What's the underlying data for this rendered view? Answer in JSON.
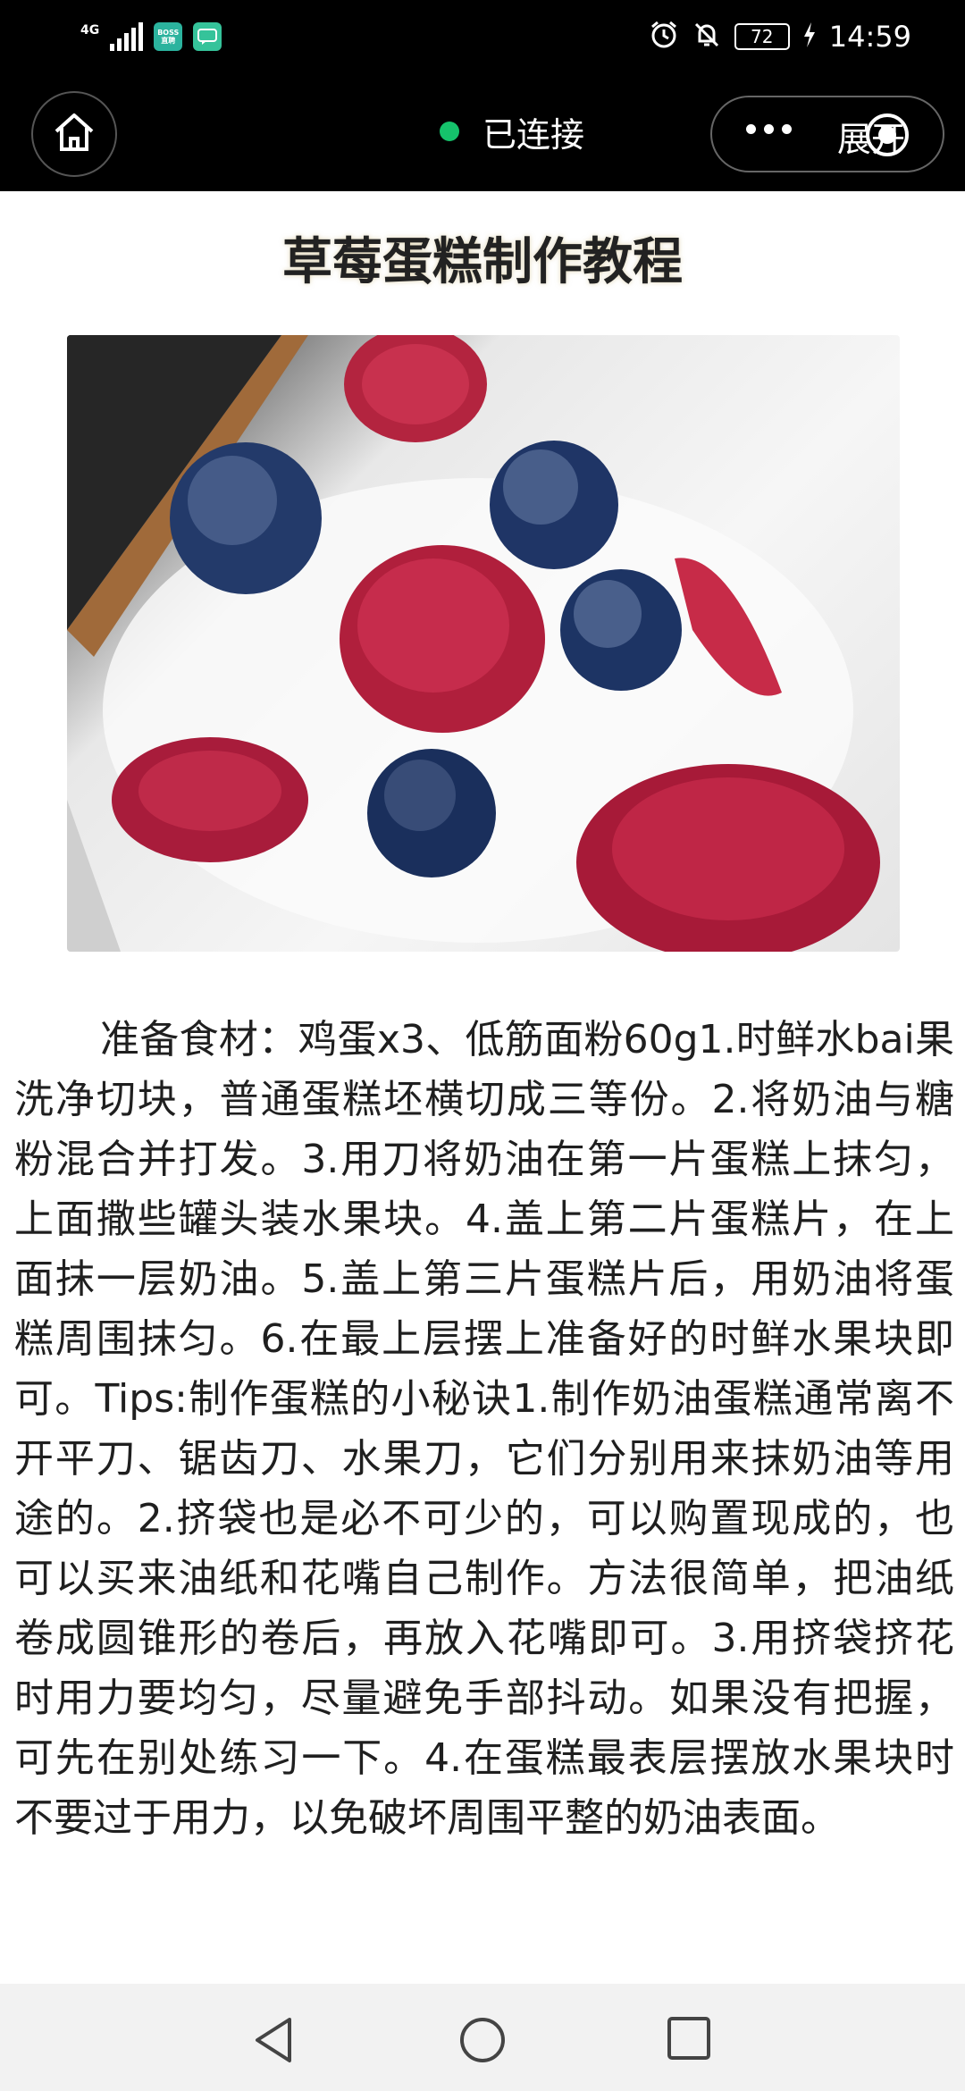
{
  "status_bar": {
    "network": "4G",
    "boss_app_label": "BOSS直聘",
    "battery": "72",
    "time": "14:59"
  },
  "nav": {
    "connection_status": "已连接",
    "expand_label": "展开"
  },
  "article": {
    "title": "草莓蛋糕制作教程",
    "image_alt": "cake-with-raspberries-and-blueberries",
    "body": "准备食材：鸡蛋x3、低筋面粉60g1.时鲜水bai果洗净切块，普通蛋糕坯横切成三等份。2.将奶油与糖粉混合并打发。3.用刀将奶油在第一片蛋糕上抹匀，上面撒些罐头装水果块。4.盖上第二片蛋糕片，在上面抹一层奶油。5.盖上第三片蛋糕片后，用奶油将蛋糕周围抹匀。6.在最上层摆上准备好的时鲜水果块即可。Tips:制作蛋糕的小秘诀1.制作奶油蛋糕通常离不开平刀、锯齿刀、水果刀，它们分别用来抹奶油等用途的。2.挤袋也是必不可少的，可以购置现成的，也可以买来油纸和花嘴自己制作。方法很简单，把油纸卷成圆锥形的卷后，再放入花嘴即可。3.用挤袋挤花时用力要均匀，尽量避免手部抖动。如果没有把握，可先在别处练习一下。4.在蛋糕最表层摆放水果块时不要过于用力，以免破坏周围平整的奶油表面。"
  },
  "colors": {
    "status_bg": "#000000",
    "connected_dot": "#15c26b",
    "text": "#1f1f1f",
    "system_nav_bg": "#f2f2f2"
  },
  "icons": {
    "home": "home-icon",
    "more": "more-dots-icon",
    "close": "target-close-icon",
    "back": "triangle-back-icon",
    "system_home": "circle-home-icon",
    "recents": "square-recents-icon"
  }
}
